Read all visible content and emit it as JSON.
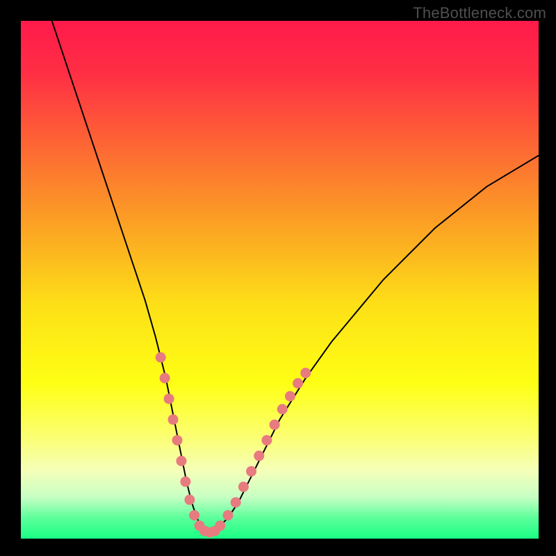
{
  "watermark": "TheBottleneck.com",
  "colors": {
    "bg": "#000000",
    "gradient_stops": [
      {
        "offset": 0.0,
        "color": "#ff1a4b"
      },
      {
        "offset": 0.1,
        "color": "#ff2e44"
      },
      {
        "offset": 0.25,
        "color": "#fd6a33"
      },
      {
        "offset": 0.4,
        "color": "#fca423"
      },
      {
        "offset": 0.55,
        "color": "#fde017"
      },
      {
        "offset": 0.7,
        "color": "#feff14"
      },
      {
        "offset": 0.8,
        "color": "#fcff6e"
      },
      {
        "offset": 0.87,
        "color": "#f4ffb9"
      },
      {
        "offset": 0.92,
        "color": "#c7ffc4"
      },
      {
        "offset": 0.96,
        "color": "#5cff9b"
      },
      {
        "offset": 1.0,
        "color": "#1aff85"
      }
    ],
    "curve_stroke": "#000000",
    "marker_fill": "#e77b7f",
    "marker_stroke": "#e77b7f"
  },
  "chart_data": {
    "type": "line",
    "title": "",
    "xlabel": "",
    "ylabel": "",
    "xlim": [
      0,
      100
    ],
    "ylim": [
      0,
      100
    ],
    "series": [
      {
        "name": "bottleneck-curve",
        "x": [
          6,
          8,
          10,
          12,
          14,
          16,
          18,
          20,
          22,
          24,
          26,
          28,
          29,
          30,
          31,
          32,
          33,
          34,
          35,
          36,
          38,
          40,
          42,
          44,
          46,
          48,
          50,
          55,
          60,
          65,
          70,
          75,
          80,
          85,
          90,
          95,
          100
        ],
        "y": [
          100,
          94,
          88,
          82,
          76,
          70,
          64,
          58,
          52,
          46,
          39,
          31,
          26,
          21,
          16,
          11,
          7,
          4,
          2,
          1,
          2,
          4,
          7,
          11,
          15,
          19,
          23,
          31,
          38,
          44,
          50,
          55,
          60,
          64,
          68,
          71,
          74
        ]
      }
    ],
    "markers": [
      {
        "name": "left-dot-1",
        "x": 27.0,
        "y": 35
      },
      {
        "name": "left-seg-1a",
        "x": 27.8,
        "y": 31
      },
      {
        "name": "left-seg-1b",
        "x": 28.6,
        "y": 27
      },
      {
        "name": "left-seg-1c",
        "x": 29.4,
        "y": 23
      },
      {
        "name": "left-dot-2",
        "x": 30.2,
        "y": 19
      },
      {
        "name": "left-seg-2a",
        "x": 31.0,
        "y": 15
      },
      {
        "name": "left-seg-2b",
        "x": 31.8,
        "y": 11
      },
      {
        "name": "left-seg-2c",
        "x": 32.6,
        "y": 7.5
      },
      {
        "name": "trough-1",
        "x": 33.5,
        "y": 4.5
      },
      {
        "name": "trough-2",
        "x": 34.5,
        "y": 2.5
      },
      {
        "name": "trough-3",
        "x": 35.5,
        "y": 1.5
      },
      {
        "name": "trough-4",
        "x": 36.5,
        "y": 1.2
      },
      {
        "name": "trough-5",
        "x": 37.5,
        "y": 1.5
      },
      {
        "name": "trough-6",
        "x": 38.5,
        "y": 2.5
      },
      {
        "name": "right-seg-1a",
        "x": 40.0,
        "y": 4.5
      },
      {
        "name": "right-seg-1b",
        "x": 41.5,
        "y": 7.0
      },
      {
        "name": "right-seg-1c",
        "x": 43.0,
        "y": 10.0
      },
      {
        "name": "right-dot-1",
        "x": 44.5,
        "y": 13.0
      },
      {
        "name": "right-seg-2a",
        "x": 46.0,
        "y": 16.0
      },
      {
        "name": "right-seg-2b",
        "x": 47.5,
        "y": 19.0
      },
      {
        "name": "right-seg-2c",
        "x": 49.0,
        "y": 22.0
      },
      {
        "name": "right-seg-2d",
        "x": 50.5,
        "y": 25.0
      },
      {
        "name": "right-seg-2e",
        "x": 52.0,
        "y": 27.5
      },
      {
        "name": "right-dot-2",
        "x": 53.5,
        "y": 30.0
      },
      {
        "name": "right-dot-3",
        "x": 55.0,
        "y": 32.0
      }
    ]
  }
}
